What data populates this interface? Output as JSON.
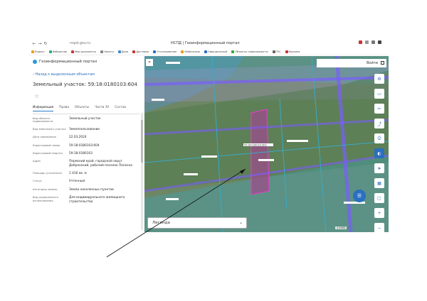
{
  "browser": {
    "url": "nspd.gov.ru",
    "tab_title": "НСПД | Геоинформационный портал",
    "bookmarks": [
      "Яндекс",
      "Избранное",
      "Мои документы",
      "Налоги",
      "Дела",
      "Доставки",
      "Отслеживание",
      "Мобильные",
      "Официальный",
      "Объекты недвижимости",
      "ТЕС",
      "Корзина",
      "Вход",
      "Реестр объектов"
    ]
  },
  "panel": {
    "portal_name": "Геоинформационный портал",
    "back_link": "Назад к выделенным объектам",
    "title": "Земельный участок: 59:18:0180103:604",
    "tabs": [
      "Информация",
      "Права",
      "Объекты",
      "Части ЗУ",
      "Состав"
    ],
    "rows": [
      {
        "k": "Вид объекта недвижимости",
        "v": "Земельный участок"
      },
      {
        "k": "Вид земельного участка",
        "v": "Землепользование"
      },
      {
        "k": "Дата присвоения",
        "v": "22.03.2024"
      },
      {
        "k": "Кадастровый номер",
        "v": "59:18:0180103:604"
      },
      {
        "k": "Кадастровый квартал",
        "v": "59:18:0180103"
      },
      {
        "k": "Адрес",
        "v": "Пермский край, городской округ Добрянский, рабочий поселок Полазна"
      },
      {
        "k": "Площадь уточненная",
        "v": "1 416 кв. м"
      },
      {
        "k": "Статус",
        "v": "Учтенный"
      },
      {
        "k": "Категория земель",
        "v": "Земли населенных пунктов"
      },
      {
        "k": "Вид разрешенного использования",
        "v": "Для индивидуального жилищного строительства"
      }
    ]
  },
  "map": {
    "login_label": "Войти",
    "collapse_icon": "«",
    "legend_label": "Легенда",
    "scale_text": "1:2000",
    "parcel_label": "59:18:0180103:604",
    "tool_icons": [
      "gear-icon",
      "layers-icon",
      "cut-icon",
      "share-icon",
      "print-icon",
      "measure-icon",
      "locate-icon",
      "grid-icon",
      "rect-icon",
      "plus-icon",
      "minus-icon"
    ]
  }
}
